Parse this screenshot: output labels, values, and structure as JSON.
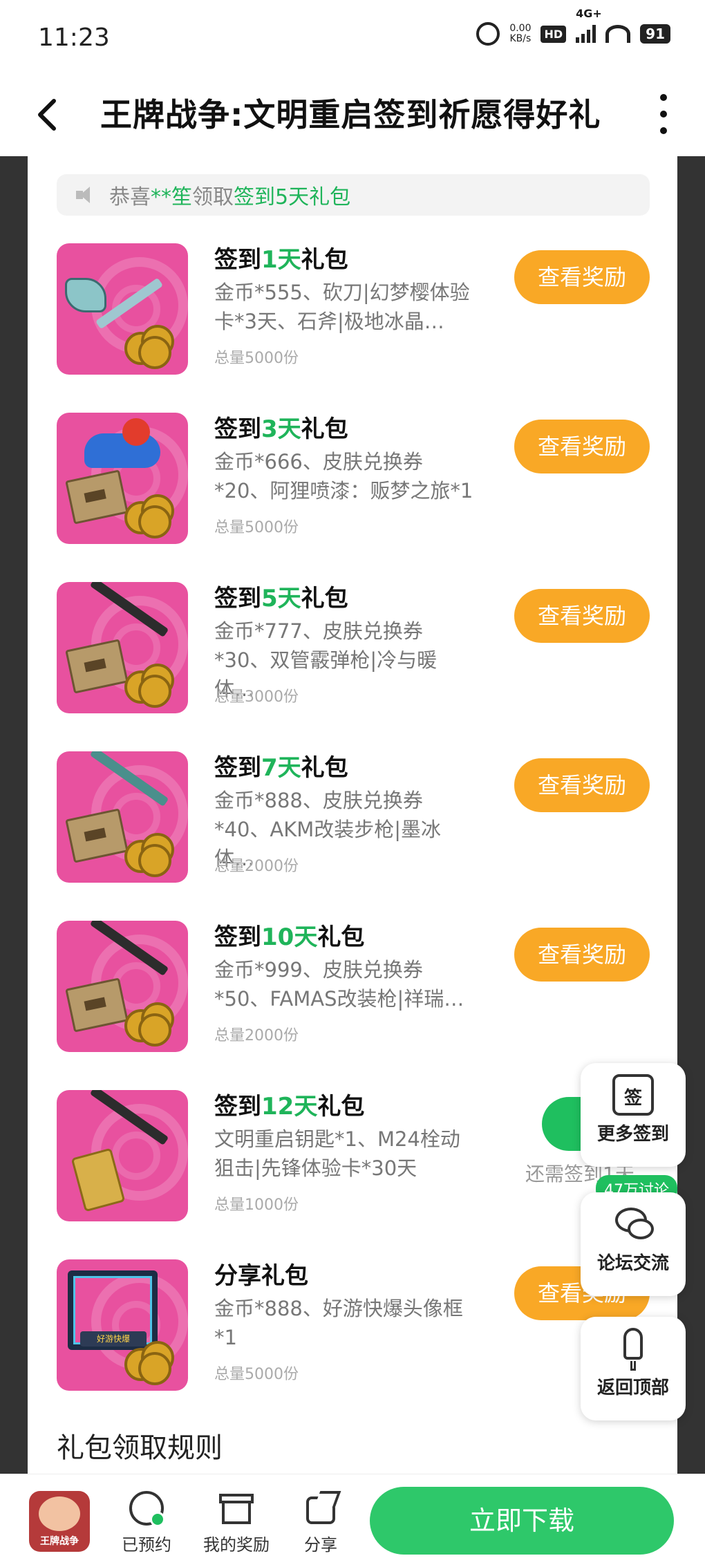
{
  "status": {
    "time": "11:23",
    "speed_value": "0.00",
    "speed_unit": "KB/s",
    "hd": "HD",
    "net": "4G+",
    "battery": "91"
  },
  "header": {
    "title": "王牌战争:文明重启签到祈愿得好礼"
  },
  "notice": {
    "prefix": "恭喜",
    "user": "**笙",
    "middle": "领取",
    "gift": "签到5天礼包"
  },
  "gifts": [
    {
      "title_pre": "签到",
      "title_num": "1天",
      "title_post": "礼包",
      "desc": "金币*555、砍刀|幻梦樱体验卡*3天、石斧|极地冰晶…",
      "total": "总量5000份",
      "button": "查看奖励"
    },
    {
      "title_pre": "签到",
      "title_num": "3天",
      "title_post": "礼包",
      "desc": "金币*666、皮肤兑换券*20、阿狸喷漆：贩梦之旅*1",
      "total": "总量5000份",
      "button": "查看奖励"
    },
    {
      "title_pre": "签到",
      "title_num": "5天",
      "title_post": "礼包",
      "desc": "金币*777、皮肤兑换券*30、双管霰弹枪|冷与暖体…",
      "total": "总量3000份",
      "button": "查看奖励"
    },
    {
      "title_pre": "签到",
      "title_num": "7天",
      "title_post": "礼包",
      "desc": "金币*888、皮肤兑换券*40、AKM改装步枪|墨冰体…",
      "total": "总量2000份",
      "button": "查看奖励"
    },
    {
      "title_pre": "签到",
      "title_num": "10天",
      "title_post": "礼包",
      "desc": "金币*999、皮肤兑换券*50、FAMAS改装枪|祥瑞…",
      "total": "总量2000份",
      "button": "查看奖励"
    },
    {
      "title_pre": "签到",
      "title_num": "12天",
      "title_post": "礼包",
      "desc": "文明重启钥匙*1、M24栓动狙击|先锋体验卡*30天",
      "total": "总量1000份",
      "button": "领取",
      "note": "还需签到1天"
    },
    {
      "title_pre": "分享礼包",
      "title_num": "",
      "title_post": "",
      "desc": "金币*888、好游快爆头像框*1",
      "total": "总量5000份",
      "button": "查看奖励",
      "frame_label": "好游快爆"
    }
  ],
  "rules": {
    "title": "礼包领取规则"
  },
  "floating": {
    "checkin_icon_text": "签",
    "checkin_label": "更多签到",
    "forum_badge": "47万讨论",
    "forum_label": "论坛交流",
    "top_label": "返回顶部"
  },
  "bottom_bar": {
    "game_icon_text": "王牌战争",
    "reserved": "已预约",
    "my_rewards": "我的奖励",
    "share": "分享",
    "download": "立即下载"
  },
  "colors": {
    "accent_green": "#1fb45a",
    "button_orange": "#f9a826",
    "thumb_pink": "#e8519f",
    "side_band": "#333333"
  }
}
